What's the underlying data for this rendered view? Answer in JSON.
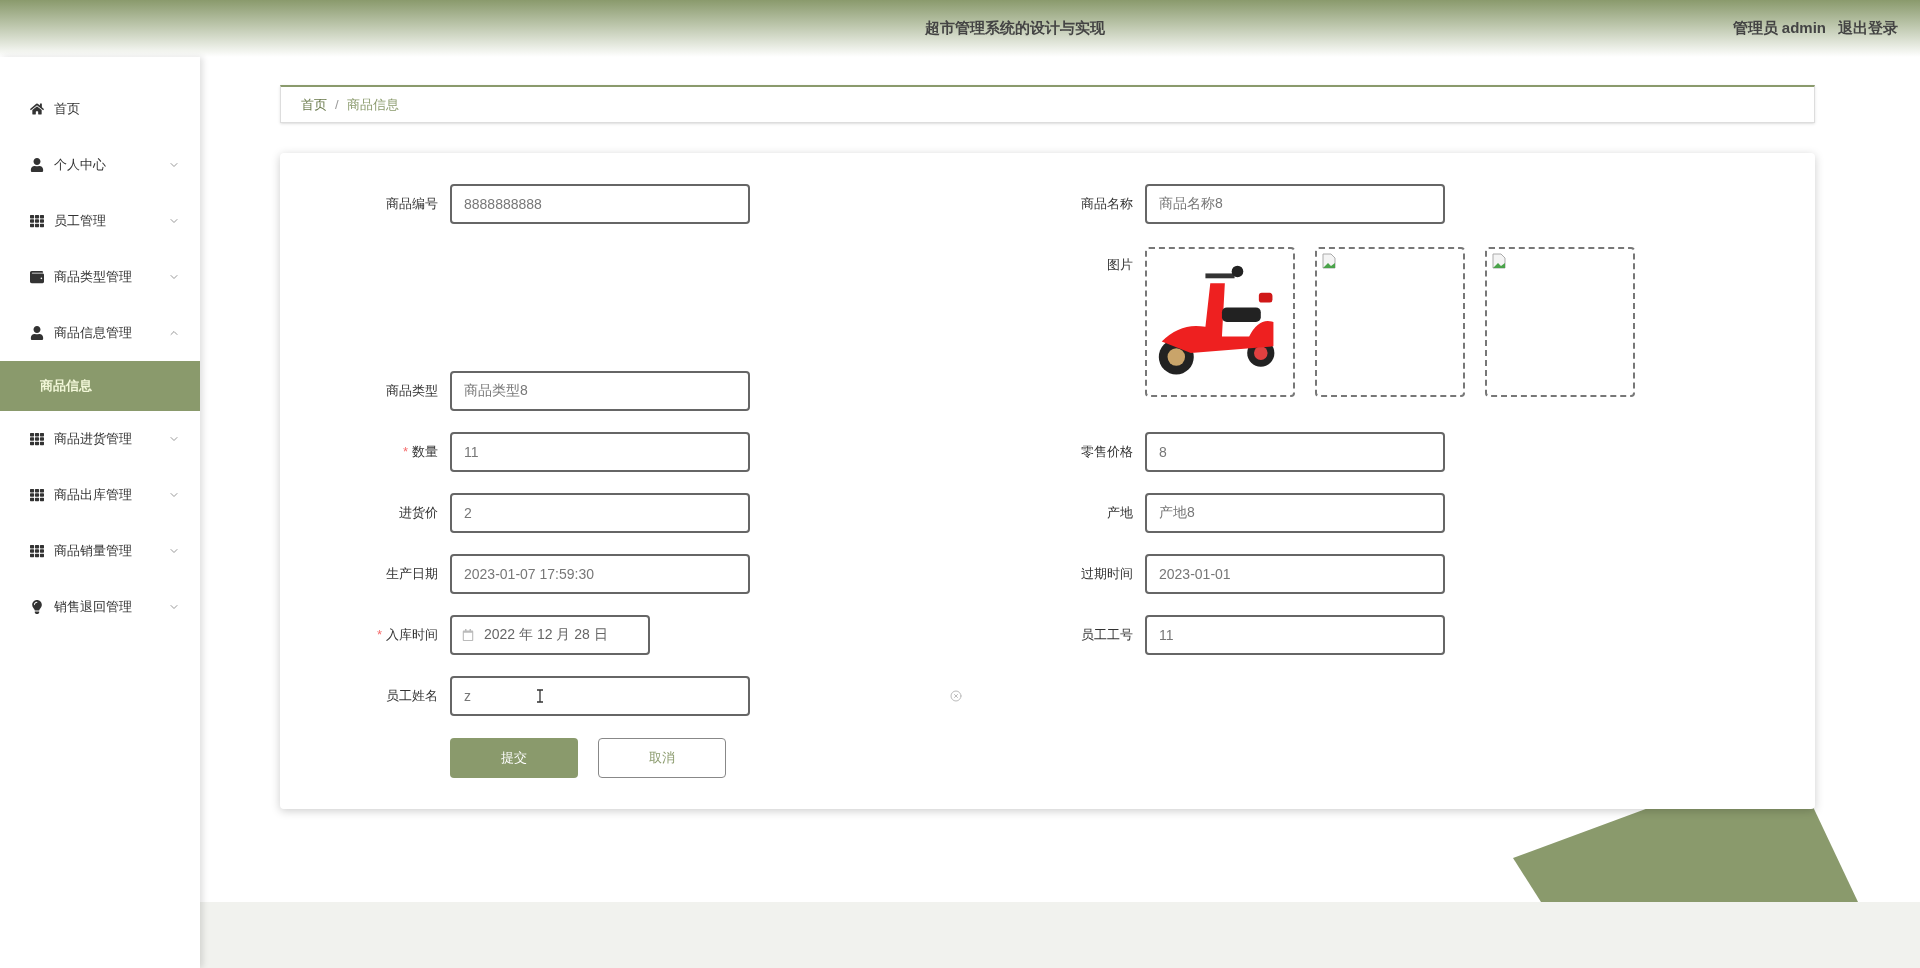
{
  "header": {
    "title": "超市管理系统的设计与实现",
    "user": "管理员 admin",
    "logout": "退出登录"
  },
  "sidebar": {
    "items": [
      {
        "label": "首页",
        "kind": "home"
      },
      {
        "label": "个人中心",
        "kind": "user",
        "expanded": false
      },
      {
        "label": "员工管理",
        "kind": "grid",
        "expanded": false
      },
      {
        "label": "商品类型管理",
        "kind": "wallet",
        "expanded": false
      },
      {
        "label": "商品信息管理",
        "kind": "user",
        "expanded": true,
        "children": [
          {
            "label": "商品信息",
            "selected": true
          }
        ]
      },
      {
        "label": "商品进货管理",
        "kind": "grid",
        "expanded": false
      },
      {
        "label": "商品出库管理",
        "kind": "grid",
        "expanded": false
      },
      {
        "label": "商品销量管理",
        "kind": "grid",
        "expanded": false
      },
      {
        "label": "销售退回管理",
        "kind": "bulb",
        "expanded": false
      }
    ]
  },
  "breadcrumb": {
    "items": [
      "首页",
      "商品信息"
    ],
    "separator": "/"
  },
  "form": {
    "code": {
      "label": "商品编号",
      "value": "8888888888"
    },
    "name": {
      "label": "商品名称",
      "value": "商品名称8"
    },
    "images": {
      "label": "图片",
      "items": [
        {
          "kind": "picture"
        },
        {
          "kind": "broken"
        },
        {
          "kind": "broken"
        }
      ]
    },
    "type": {
      "label": "商品类型",
      "value": "商品类型8"
    },
    "rows": [
      [
        {
          "label": "数量",
          "value": "11",
          "required_mark": "*",
          "kind": "text"
        },
        {
          "label": "零售价格",
          "value": "8",
          "kind": "text"
        }
      ],
      [
        {
          "label": "进货价",
          "value": "2",
          "kind": "text"
        },
        {
          "label": "产地",
          "value": "产地8",
          "kind": "text"
        }
      ],
      [
        {
          "label": "生产日期",
          "value": "2023-01-07 17:59:30",
          "kind": "text"
        },
        {
          "label": "过期时间",
          "value": "2023-01-01",
          "kind": "text"
        }
      ],
      [
        {
          "label": "入库时间",
          "value": "2022 年 12 月 28 日",
          "required_mark": "*",
          "kind": "date"
        },
        {
          "label": "员工工号",
          "value": "11",
          "kind": "text"
        }
      ],
      [
        {
          "label": "员工姓名",
          "value": "z",
          "kind": "typing"
        },
        null
      ]
    ],
    "buttons": [
      {
        "label": "提交",
        "kind": "primary"
      },
      {
        "label": "取消",
        "kind": "secondary"
      }
    ]
  }
}
